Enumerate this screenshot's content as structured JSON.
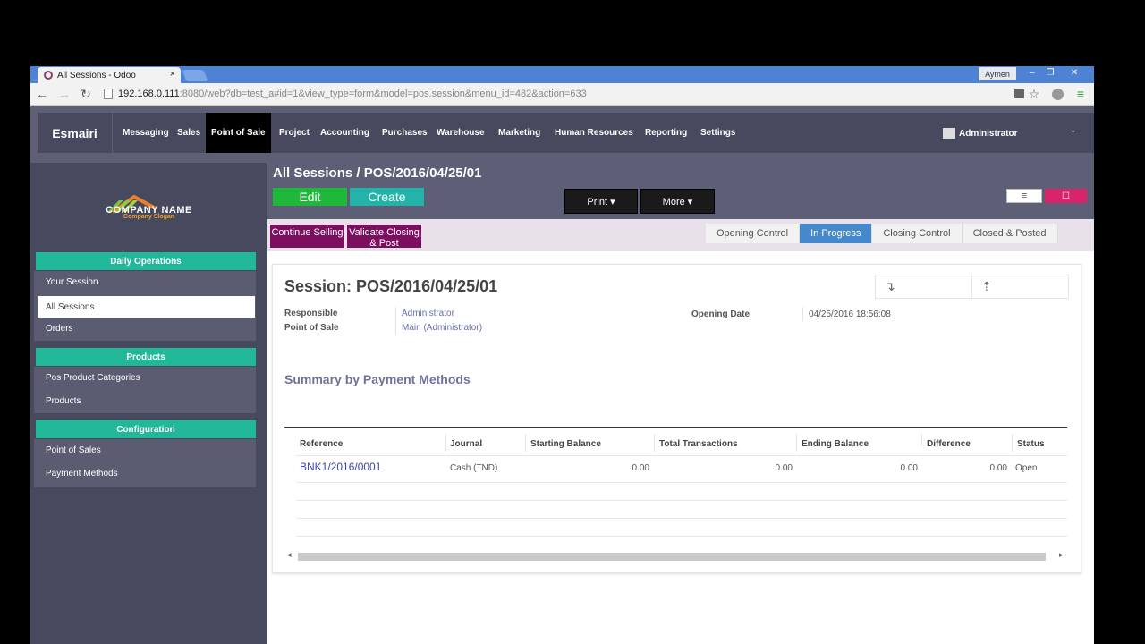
{
  "browser": {
    "tab_title": "All Sessions - Odoo",
    "tab_close": "×",
    "window_user": "Aymen",
    "controls": {
      "minimize": "–",
      "restore": "❐",
      "close": "✕"
    },
    "url_host": "192.168.0.111",
    "url_rest": ":8080/web?db=test_a#id=1&view_type=form&model=pos.session&menu_id=482&action=633",
    "nav": {
      "back": "←",
      "forward": "→",
      "reload": "↻",
      "star": "☆",
      "menu": "≡"
    }
  },
  "topnav": {
    "brand": "Esmairi",
    "menu": [
      "Messaging",
      "Sales",
      "Point of Sale",
      "Project",
      "Accounting",
      "Purchases",
      "Warehouse",
      "Marketing",
      "Human Resources",
      "Reporting",
      "Settings"
    ],
    "active": "Point of Sale",
    "user": "Administrator",
    "user_caret": "⌄"
  },
  "sidebar": {
    "company_name": "COMPANY NAME",
    "company_slogan": "Company Slogan",
    "sections": [
      {
        "header": "Daily Operations",
        "items": [
          "Your Session",
          "All Sessions",
          "Orders"
        ]
      },
      {
        "header": "Products",
        "items": [
          "Pos Product Categories",
          "Products"
        ]
      },
      {
        "header": "Configuration",
        "items": [
          "Point of Sales",
          "Payment Methods"
        ]
      }
    ],
    "active_item": "All Sessions"
  },
  "control_panel": {
    "breadcrumb": "All Sessions / POS/2016/04/25/01",
    "edit": "Edit",
    "create": "Create",
    "print": "Print ▾",
    "more": "More ▾",
    "list_icon": "≡",
    "form_icon": "☐"
  },
  "status": {
    "continue_selling": "Continue Selling",
    "validate_closing": "Validate Closing & Post",
    "stages": [
      "Opening Control",
      "In Progress",
      "Closing Control",
      "Closed & Posted"
    ],
    "active_stage": "In Progress"
  },
  "form": {
    "title": "Session: POS/2016/04/25/01",
    "stat_down": "↴",
    "stat_up": "⇡",
    "responsible_label": "Responsible",
    "responsible_value": "Administrator",
    "pos_label": "Point of Sale",
    "pos_value": "Main (Administrator)",
    "opening_date_label": "Opening Date",
    "opening_date_value": "04/25/2016 18:56:08",
    "summary_title": "Summary by Payment Methods",
    "table": {
      "headers": [
        "Reference",
        "Journal",
        "Starting Balance",
        "Total Transactions",
        "Ending Balance",
        "Difference",
        "Status"
      ],
      "rows": [
        {
          "reference": "BNK1/2016/0001",
          "journal": "Cash (TND)",
          "starting": "0.00",
          "transactions": "0.00",
          "ending": "0.00",
          "difference": "0.00",
          "status": "Open"
        }
      ]
    },
    "scroll_left": "◂",
    "scroll_right": "▸"
  }
}
